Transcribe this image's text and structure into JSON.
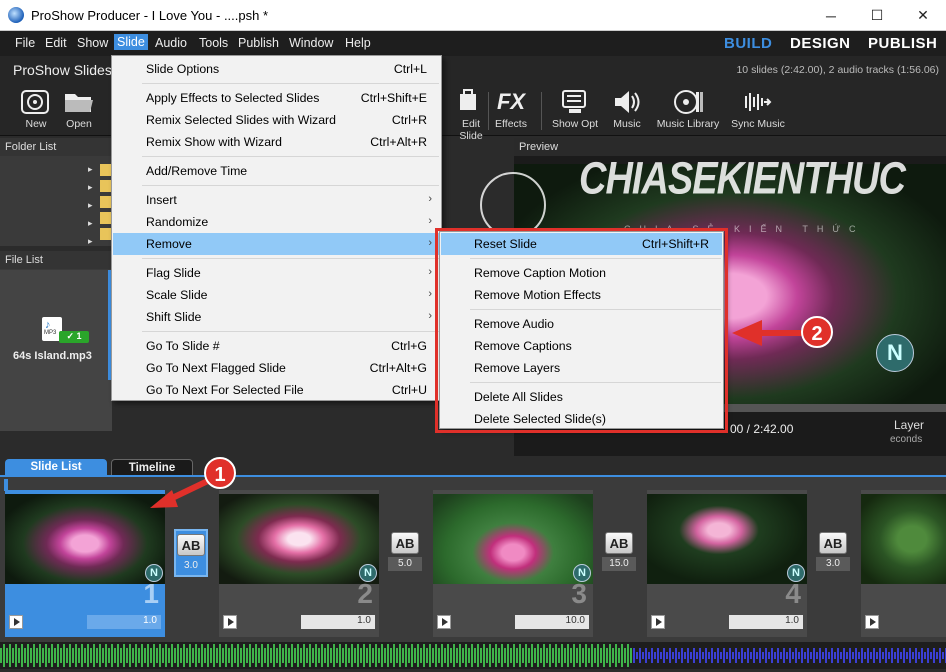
{
  "window": {
    "title": "ProShow Producer - I Love You - ....psh *",
    "minimize": "─",
    "maximize": "☐",
    "close": "✕"
  },
  "menubar": {
    "items": [
      "File",
      "Edit",
      "Show",
      "Slide",
      "Audio",
      "Tools",
      "Publish",
      "Window",
      "Help"
    ],
    "active": "Slide",
    "modes": [
      "BUILD",
      "DESIGN",
      "PUBLISH"
    ],
    "active_mode": "BUILD"
  },
  "header": {
    "title": "ProShow Slides",
    "stats": "10 slides (2:42.00), 2 audio tracks (1:56.06)"
  },
  "toolbar": {
    "left": [
      {
        "label": "New",
        "icon": "new-icon"
      },
      {
        "label": "Open",
        "icon": "open-folder-icon"
      }
    ],
    "right": [
      {
        "label": "Edit Slide",
        "icon": "edit-slide-icon"
      },
      {
        "label": "Effects",
        "icon": "fx-icon"
      },
      {
        "label": "Show Opt",
        "icon": "show-options-icon"
      },
      {
        "label": "Music",
        "icon": "speaker-icon"
      },
      {
        "label": "Music Library",
        "icon": "music-library-icon"
      },
      {
        "label": "Sync Music",
        "icon": "sync-music-icon"
      }
    ]
  },
  "panels": {
    "folder_list": "Folder List",
    "file_list": "File List",
    "file_item": {
      "name": "64s Island.mp3",
      "badge": "1",
      "ext": "MP3"
    },
    "preview": "Preview",
    "preview_time": "00 / 2:42.00",
    "preview_layer": "Layer",
    "preview_seconds": "econds"
  },
  "watermark": {
    "text": "CHIASEKIENTHUC",
    "sub": "CHIA SẺ KIẾN THỨC"
  },
  "slide_menu": [
    {
      "label": "Slide Options",
      "shortcut": "Ctrl+L"
    },
    {
      "divider": true
    },
    {
      "label": "Apply Effects to Selected Slides",
      "shortcut": "Ctrl+Shift+E"
    },
    {
      "label": "Remix Selected Slides with Wizard",
      "shortcut": "Ctrl+R"
    },
    {
      "label": "Remix Show with Wizard",
      "shortcut": "Ctrl+Alt+R"
    },
    {
      "divider": true
    },
    {
      "label": "Add/Remove Time",
      "shortcut": ""
    },
    {
      "divider": true
    },
    {
      "label": "Insert",
      "submenu": true
    },
    {
      "label": "Randomize",
      "submenu": true
    },
    {
      "label": "Remove",
      "submenu": true,
      "highlighted": true
    },
    {
      "divider": true
    },
    {
      "label": "Flag Slide",
      "submenu": true
    },
    {
      "label": "Scale Slide",
      "submenu": true
    },
    {
      "label": "Shift Slide",
      "submenu": true
    },
    {
      "divider": true
    },
    {
      "label": "Go To Slide #",
      "shortcut": "Ctrl+G"
    },
    {
      "label": "Go To Next Flagged Slide",
      "shortcut": "Ctrl+Alt+G"
    },
    {
      "label": "Go To Next For Selected File",
      "shortcut": "Ctrl+U"
    }
  ],
  "remove_submenu": [
    {
      "label": "Reset Slide",
      "shortcut": "Ctrl+Shift+R",
      "highlighted": true
    },
    {
      "divider": true
    },
    {
      "label": "Remove Caption Motion",
      "shortcut": ""
    },
    {
      "label": "Remove Motion Effects",
      "shortcut": ""
    },
    {
      "divider": true
    },
    {
      "label": "Remove Audio",
      "shortcut": ""
    },
    {
      "label": "Remove Captions",
      "shortcut": ""
    },
    {
      "label": "Remove Layers",
      "shortcut": ""
    },
    {
      "divider": true
    },
    {
      "label": "Delete All Slides",
      "shortcut": ""
    },
    {
      "label": "Delete Selected Slide(s)",
      "shortcut": ""
    }
  ],
  "tabs": {
    "slide_list": "Slide List",
    "timeline": "Timeline"
  },
  "slides": [
    {
      "number": "1",
      "duration": "1.0",
      "selected": true,
      "transition": "3.0"
    },
    {
      "number": "2",
      "duration": "1.0",
      "selected": false,
      "transition": "5.0"
    },
    {
      "number": "3",
      "duration": "10.0",
      "selected": false,
      "transition": "15.0"
    },
    {
      "number": "4",
      "duration": "1.0",
      "selected": false,
      "transition": "3.0"
    }
  ],
  "transition_icon_text": "AB",
  "annotations": {
    "callout_1": "1",
    "callout_2": "2"
  },
  "colors": {
    "accent": "#3d8ee0",
    "menu_highlight": "#91c9f7",
    "annotation_red": "#e0302a",
    "audio_green": "#3fb54a",
    "audio_blue": "#3b3fd4"
  }
}
